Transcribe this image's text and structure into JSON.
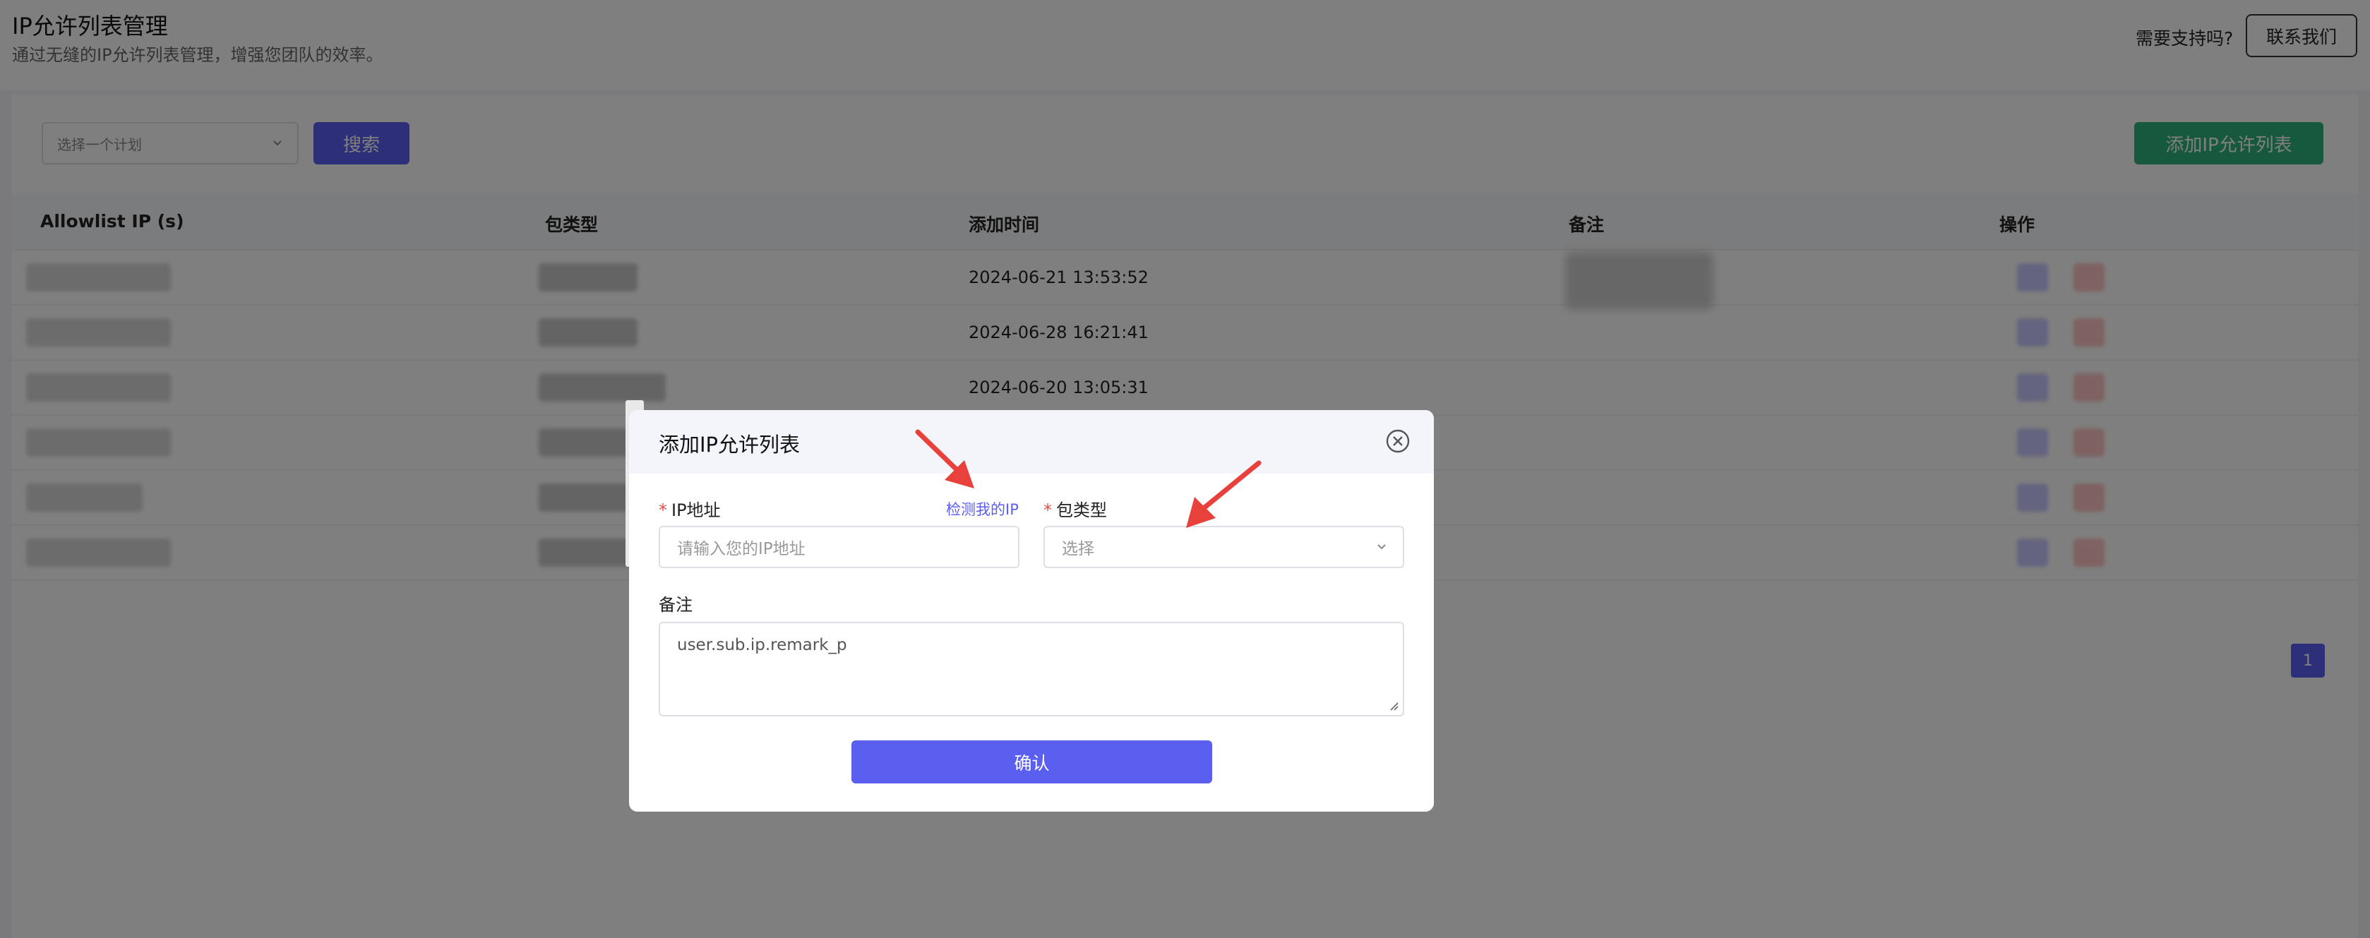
{
  "header": {
    "title": "IP允许列表管理",
    "subtitle": "通过无缝的IP允许列表管理，增强您团队的效率。",
    "support_text": "需要支持吗?",
    "contact_label": "联系我们"
  },
  "toolbar": {
    "plan_placeholder": "选择一个计划",
    "search_label": "搜索",
    "add_label": "添加IP允许列表"
  },
  "table": {
    "columns": [
      "Allowlist IP (s)",
      "包类型",
      "添加时间",
      "备注",
      "操作"
    ],
    "rows": [
      {
        "time": "2024-06-21 13:53:52"
      },
      {
        "time": "2024-06-28 16:21:41"
      },
      {
        "time": "2024-06-20 13:05:31"
      },
      {
        "time": ""
      },
      {
        "time": ""
      },
      {
        "time": ""
      }
    ]
  },
  "pagination": {
    "current": "1"
  },
  "modal": {
    "title": "添加IP允许列表",
    "ip_label": "IP地址",
    "detect_link": "检测我的IP",
    "ip_placeholder": "请输入您的IP地址",
    "package_label": "包类型",
    "package_placeholder": "选择",
    "remark_label": "备注",
    "remark_value": "user.sub.ip.remark_p",
    "confirm_label": "确认",
    "required_mark": "*"
  },
  "colors": {
    "primary": "#5b5ff0",
    "success": "#2fb37a",
    "danger": "#e34d4d",
    "arrow": "#e8403a"
  },
  "icons": {
    "close": "circle-x-icon",
    "chevron": "chevron-down-icon",
    "annotation": "red-arrow-icon"
  }
}
